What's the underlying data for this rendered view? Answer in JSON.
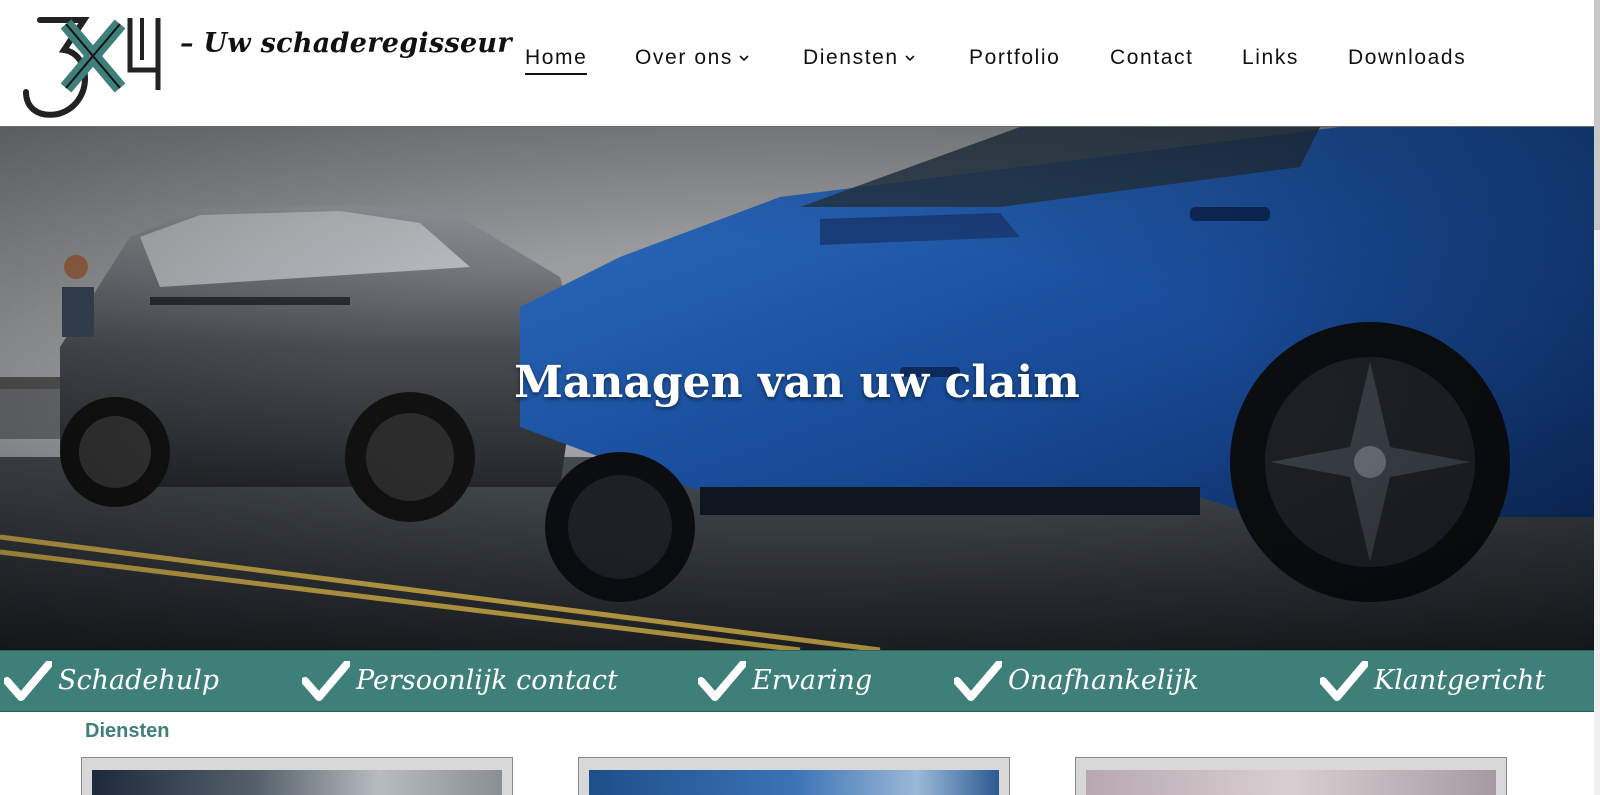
{
  "header": {
    "logo_text": "3X4",
    "tagline": "– Uw schaderegisseur"
  },
  "nav": {
    "items": [
      {
        "label": "Home",
        "active": true,
        "dropdown": false
      },
      {
        "label": "Over ons",
        "active": false,
        "dropdown": true
      },
      {
        "label": "Diensten",
        "active": false,
        "dropdown": true
      },
      {
        "label": "Portfolio",
        "active": false,
        "dropdown": false
      },
      {
        "label": "Contact",
        "active": false,
        "dropdown": false
      },
      {
        "label": "Links",
        "active": false,
        "dropdown": false
      },
      {
        "label": "Downloads",
        "active": false,
        "dropdown": false
      }
    ]
  },
  "hero": {
    "title": "Managen van uw claim"
  },
  "usps": {
    "items": [
      {
        "label": "Schadehulp",
        "icon": "checkmark-icon"
      },
      {
        "label": "Persoonlijk contact",
        "icon": "checkmark-icon"
      },
      {
        "label": "Ervaring",
        "icon": "checkmark-icon"
      },
      {
        "label": "Onafhankelijk",
        "icon": "checkmark-icon"
      },
      {
        "label": "Klantgericht",
        "icon": "checkmark-icon"
      }
    ]
  },
  "section": {
    "title": "Diensten"
  },
  "colors": {
    "accent": "#3f7f7a",
    "text": "#111111"
  }
}
